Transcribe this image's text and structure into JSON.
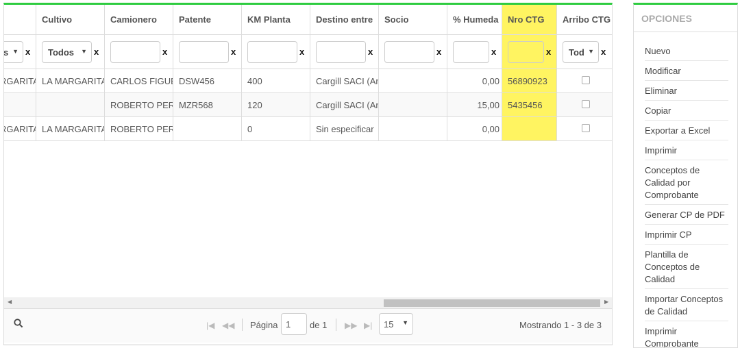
{
  "grid": {
    "columns": [
      {
        "key": "c0",
        "label": ""
      },
      {
        "key": "cultivo",
        "label": "Cultivo"
      },
      {
        "key": "camionero",
        "label": "Camionero"
      },
      {
        "key": "patente",
        "label": "Patente"
      },
      {
        "key": "km",
        "label": "KM Planta"
      },
      {
        "key": "destino",
        "label": "Destino entre"
      },
      {
        "key": "socio",
        "label": "Socio"
      },
      {
        "key": "humedad",
        "label": "% Humeda"
      },
      {
        "key": "ctg",
        "label": "Nro CTG"
      },
      {
        "key": "arribo",
        "label": "Arribo CTG"
      }
    ],
    "filters": {
      "c0_select": "s",
      "cultivo_select": "Todos",
      "arribo_select": "Tod",
      "clear_label": "x"
    },
    "rows": [
      {
        "c0": "RGARITA",
        "cultivo": "LA MARGARITA",
        "camionero": "CARLOS FIGUEI",
        "patente": "DSW456",
        "km": "400",
        "destino": "Cargill SACI (Am",
        "socio": "",
        "humedad": "0,00",
        "ctg": "56890923"
      },
      {
        "c0": "",
        "cultivo": "",
        "camionero": "ROBERTO PERA",
        "patente": "MZR568",
        "km": "120",
        "destino": "Cargill SACI (Am",
        "socio": "",
        "humedad": "15,00",
        "ctg": "5435456"
      },
      {
        "c0": "RGARITA",
        "cultivo": "LA MARGARITA",
        "camionero": "ROBERTO PERA",
        "patente": "",
        "km": "0",
        "destino": "Sin especificar",
        "socio": "",
        "humedad": "0,00",
        "ctg": ""
      }
    ]
  },
  "pager": {
    "page_label": "Página",
    "page_value": "1",
    "of_label": "de 1",
    "page_size": "15",
    "showing": "Mostrando 1 - 3 de 3"
  },
  "sidebar": {
    "title": "OPCIONES",
    "items": [
      {
        "label": "Nuevo"
      },
      {
        "label": "Modificar"
      },
      {
        "label": "Eliminar"
      },
      {
        "label": "Copiar"
      },
      {
        "label": "Exportar a Excel"
      },
      {
        "label": "Imprimir"
      },
      {
        "label": "Conceptos de Calidad por Comprobante"
      },
      {
        "label": "Generar CP de PDF"
      },
      {
        "label": "Imprimir CP"
      },
      {
        "label": "Plantilla de Conceptos de Calidad"
      },
      {
        "label": "Importar Conceptos de Calidad"
      },
      {
        "label": "Imprimir Comprobante"
      }
    ]
  },
  "colors": {
    "accent": "#2ecc40",
    "highlight": "#fff461"
  }
}
